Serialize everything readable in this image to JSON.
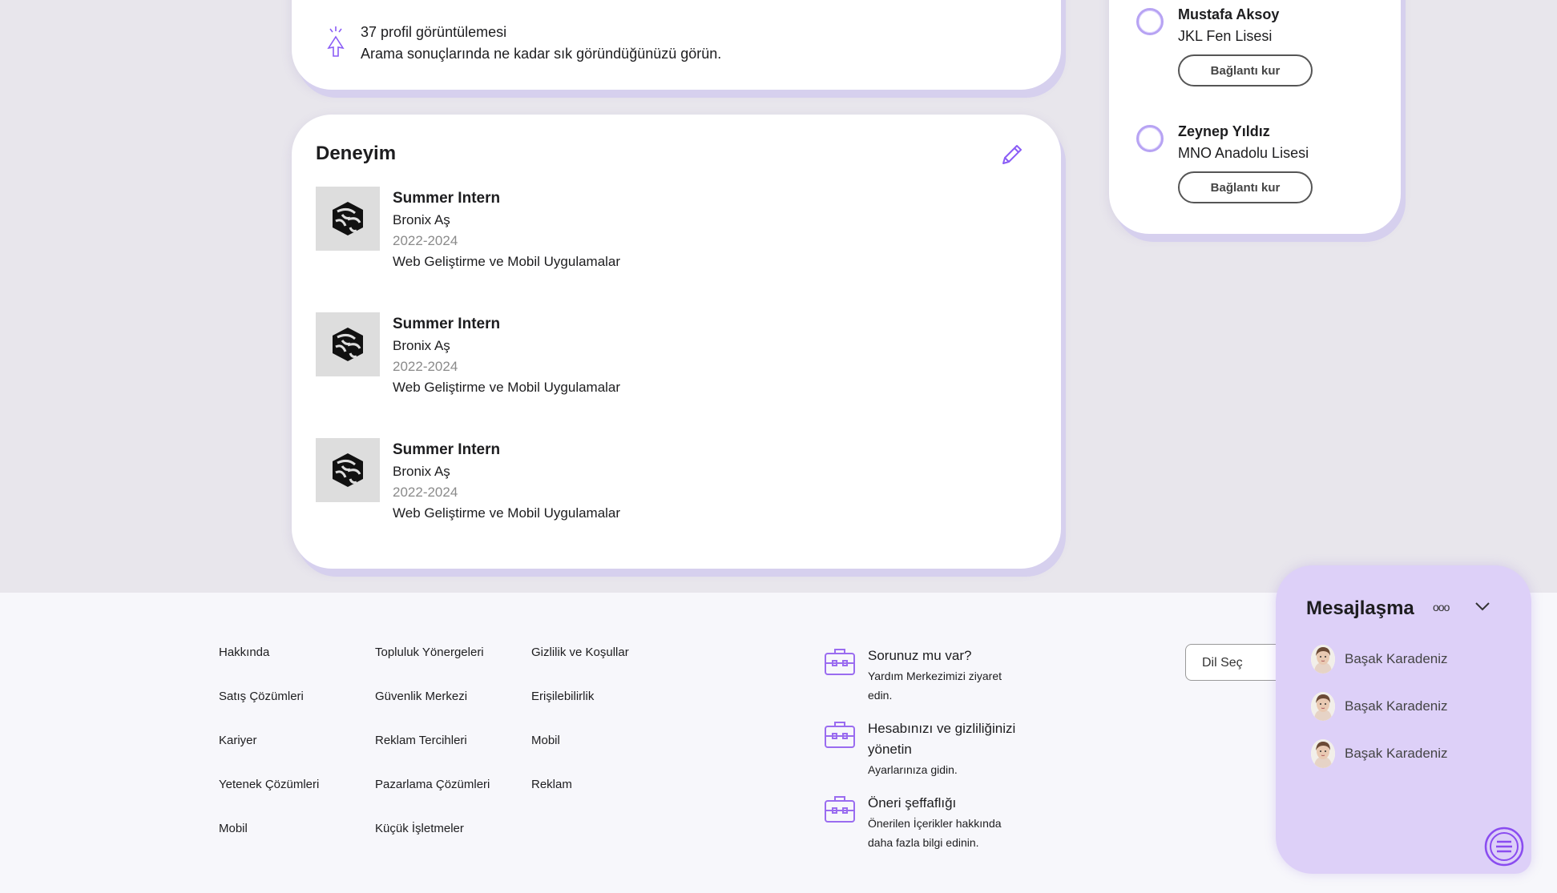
{
  "stats": {
    "views_count": "37 profil görüntülemesi",
    "views_desc": "Arama sonuçlarında ne kadar sık göründüğünüzü görün."
  },
  "experience": {
    "title": "Deneyim",
    "items": [
      {
        "role": "Summer Intern",
        "company": "Bronix Aş",
        "dates": "2022-2024",
        "desc": "Web Geliştirme ve Mobil Uygulamalar"
      },
      {
        "role": "Summer Intern",
        "company": "Bronix Aş",
        "dates": "2022-2024",
        "desc": "Web Geliştirme ve Mobil Uygulamalar"
      },
      {
        "role": "Summer Intern",
        "company": "Bronix Aş",
        "dates": "2022-2024",
        "desc": "Web Geliştirme ve Mobil Uygulamalar"
      }
    ]
  },
  "people": [
    {
      "name": "Mustafa Aksoy",
      "school": "JKL Fen Lisesi",
      "button": "Bağlantı kur"
    },
    {
      "name": "Zeynep Yıldız",
      "school": "MNO Anadolu Lisesi",
      "button": "Bağlantı kur"
    }
  ],
  "footer": {
    "col1": [
      "Hakkında",
      "Satış Çözümleri",
      "Kariyer",
      "Yetenek Çözümleri",
      "Mobil"
    ],
    "col2": [
      "Topluluk Yönergeleri",
      "Güvenlik Merkezi",
      "Reklam Tercihleri",
      "Pazarlama Çözümleri",
      "Küçük İşletmeler"
    ],
    "col3": [
      "Gizlilik ve Koşullar",
      "Erişilebilirlik",
      "Mobil",
      "Reklam"
    ],
    "help": [
      {
        "title": "Sorunuz mu var?",
        "desc": "Yardım Merkezimizi ziyaret edin."
      },
      {
        "title": "Hesabınızı ve gizliliğinizi yönetin",
        "desc": "Ayarlarınıza gidin."
      },
      {
        "title": "Öneri şeffaflığı",
        "desc": "Önerilen İçerikler hakkında daha fazla bilgi edinin."
      }
    ],
    "language_label": "Dil Seç"
  },
  "messaging": {
    "title": "Mesajlaşma",
    "contacts": [
      "Başak Karadeniz",
      "Başak Karadeniz",
      "Başak Karadeniz"
    ]
  },
  "colors": {
    "accent": "#8a5cf6",
    "panel": "#ddd0f8",
    "background": "#e8e6ec"
  }
}
